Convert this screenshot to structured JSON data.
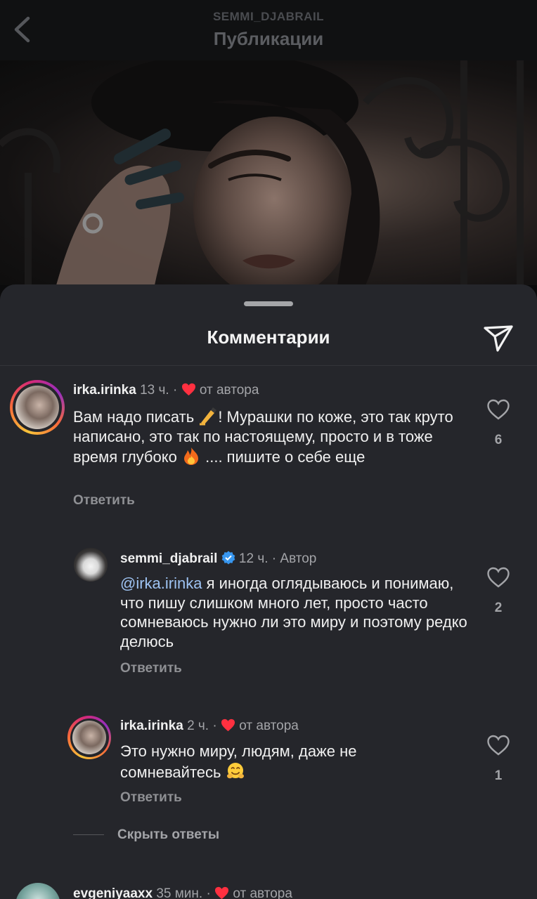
{
  "header": {
    "subtitle": "SEMMI_DJABRAIL",
    "title": "Публикации"
  },
  "sheet": {
    "title": "Комментарии"
  },
  "comments": [
    {
      "username": "irka.irinka",
      "time": "13 ч.",
      "separator": "·",
      "badge": "от автора",
      "text_before_emoji1": "Вам надо писать ",
      "text_after_emoji1": "! Мурашки по коже, это так круто написано, это так по настоящему, просто и в тоже время глубоко ",
      "text_after_emoji2": " .... пишите о себе еще",
      "emoji1": "writing-hand-icon",
      "emoji2": "fire-icon",
      "reply_label": "Ответить",
      "likes": "6"
    },
    {
      "username": "semmi_djabrail",
      "time": "12 ч.",
      "separator": "·",
      "badge": "Автор",
      "mention": "@irka.irinka",
      "text": " я иногда оглядываюсь и понимаю, что пишу слишком много лет, просто часто сомневаюсь нужно ли это миру и поэтому редко делюсь",
      "reply_label": "Ответить",
      "likes": "2"
    },
    {
      "username": "irka.irinka",
      "time": "2 ч.",
      "separator": "·",
      "badge": "от автора",
      "text": "Это нужно миру, людям, даже не сомневайтесь ",
      "emoji": "hugging-face-icon",
      "reply_label": "Ответить",
      "likes": "1"
    },
    {
      "username": "evgeniyaaxx",
      "time": "35 мин.",
      "separator": "·",
      "badge": "от автора"
    }
  ],
  "hide_replies_label": "Скрыть ответы",
  "colors": {
    "heart_red": "#ff3040",
    "mention_blue": "#9ec3f2",
    "verified_blue": "#3897f0",
    "sheet_bg": "#25262b"
  }
}
